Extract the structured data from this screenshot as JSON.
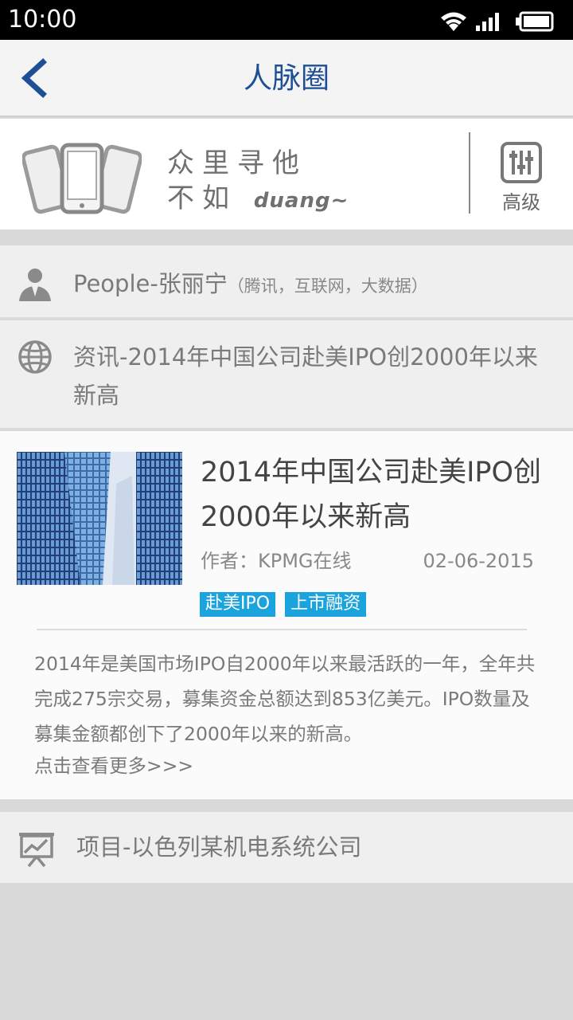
{
  "status_bar": {
    "time": "10:00",
    "icons": [
      "wifi-icon",
      "signal-icon",
      "battery-icon"
    ]
  },
  "nav": {
    "back_icon": "chevron-left-icon",
    "title": "人脉圈"
  },
  "banner": {
    "slogan_line1": "众里寻他",
    "slogan_line2_prefix": "不如",
    "slogan_line2_suffix": "duang~",
    "advanced_label": "高级",
    "advanced_icon": "sliders-icon"
  },
  "people_row": {
    "icon": "person-icon",
    "label": "People-张丽宁",
    "sub": "（腾讯，互联网，大数据）"
  },
  "news_row": {
    "icon": "globe-icon",
    "label": "资讯-2014年中国公司赴美IPO创2000年以来新高"
  },
  "article": {
    "title": "2014年中国公司赴美IPO创2000年以来新高",
    "author": "作者：KPMG在线",
    "date": "02-06-2015",
    "tags": [
      "赴美IPO",
      "上市融资"
    ],
    "body": "2014年是美国市场IPO自2000年以来最活跃的一年，全年共完成275宗交易，募集资金总额达到853亿美元。IPO数量及募集金额都创下了2000年以来的新高。",
    "read_more": "点击查看更多>>>"
  },
  "project_row": {
    "icon": "presentation-chart-icon",
    "label": "项目-以色列某机电系统公司"
  },
  "colors": {
    "accent": "#1d4f96",
    "tag": "#1aa3dd",
    "background": "#d9d9d9"
  }
}
